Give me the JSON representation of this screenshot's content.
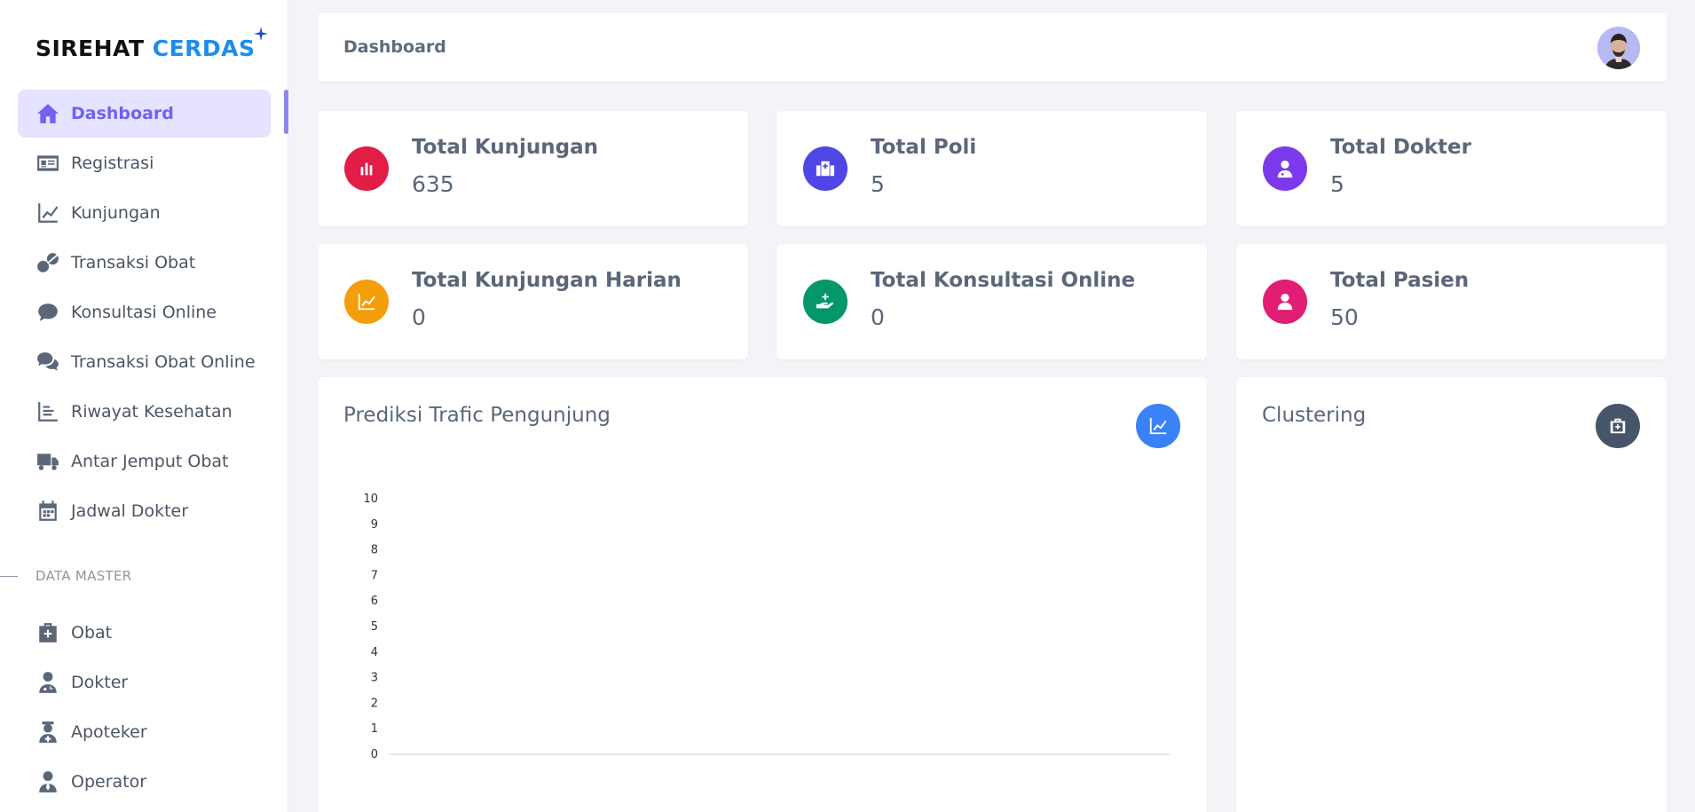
{
  "brand": {
    "part1": "SIREHAT",
    "part2": "CERDAS"
  },
  "colors": {
    "accent": "#6f63f0",
    "active_bg": "#e5e3ff",
    "brand_blue": "#1d8cf0"
  },
  "sidebar": {
    "items": [
      {
        "label": "Dashboard",
        "icon": "home-icon"
      },
      {
        "label": "Registrasi",
        "icon": "id-card-icon"
      },
      {
        "label": "Kunjungan",
        "icon": "line-chart-icon"
      },
      {
        "label": "Transaksi Obat",
        "icon": "pills-icon"
      },
      {
        "label": "Konsultasi Online",
        "icon": "comment-icon"
      },
      {
        "label": "Transaksi Obat Online",
        "icon": "comments-icon"
      },
      {
        "label": "Riwayat Kesehatan",
        "icon": "list-chart-icon"
      },
      {
        "label": "Antar Jemput Obat",
        "icon": "truck-icon"
      },
      {
        "label": "Jadwal Dokter",
        "icon": "calendar-icon"
      }
    ],
    "section_title": "DATA MASTER",
    "master_items": [
      {
        "label": "Obat",
        "icon": "medkit-icon"
      },
      {
        "label": "Dokter",
        "icon": "doctor-icon"
      },
      {
        "label": "Apoteker",
        "icon": "pharmacist-icon"
      },
      {
        "label": "Operator",
        "icon": "operator-icon"
      }
    ]
  },
  "header": {
    "breadcrumb": "Dashboard"
  },
  "stats": [
    {
      "title": "Total Kunjungan",
      "value": "635",
      "color": "#e11d48",
      "icon": "bar-chart-icon"
    },
    {
      "title": "Total Poli",
      "value": "5",
      "color": "#4f46e5",
      "icon": "hospital-icon"
    },
    {
      "title": "Total Dokter",
      "value": "5",
      "color": "#7c3aed",
      "icon": "doctor-icon"
    },
    {
      "title": "Total Kunjungan Harian",
      "value": "0",
      "color": "#f59e0b",
      "icon": "line-chart-icon"
    },
    {
      "title": "Total Konsultasi Online",
      "value": "0",
      "color": "#059669",
      "icon": "hand-plus-icon"
    },
    {
      "title": "Total Pasien",
      "value": "50",
      "color": "#e11d74",
      "icon": "user-icon"
    }
  ],
  "panels": {
    "traffic": {
      "title": "Prediksi Trafic Pengunjung",
      "button_color": "#3b82f6",
      "button_icon": "line-chart-icon"
    },
    "clustering": {
      "title": "Clustering",
      "button_color": "#475569",
      "button_icon": "medkit-icon"
    }
  },
  "chart_data": {
    "type": "line",
    "title": "",
    "xlabel": "",
    "ylabel": "",
    "ylim": [
      0,
      10
    ],
    "yticks": [
      "10",
      "9",
      "8",
      "7",
      "6",
      "5",
      "4",
      "3",
      "2",
      "1",
      "0"
    ],
    "series": []
  }
}
